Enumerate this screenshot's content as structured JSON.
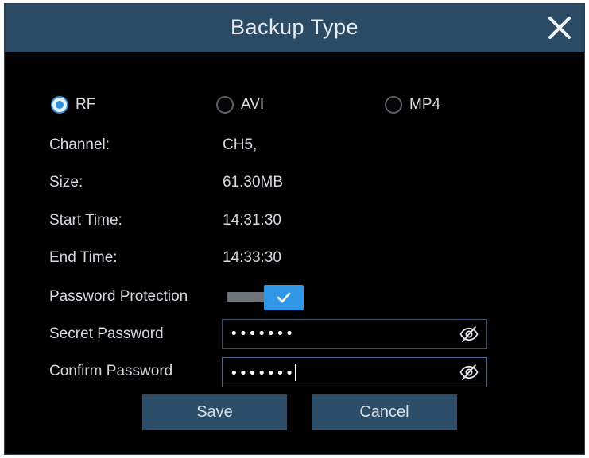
{
  "dialog": {
    "title": "Backup Type",
    "close_icon": "close-icon"
  },
  "backup_format": {
    "options": [
      {
        "label": "RF",
        "checked": true
      },
      {
        "label": "AVI",
        "checked": false
      },
      {
        "label": "MP4",
        "checked": false
      }
    ]
  },
  "info": {
    "channel_label": "Channel:",
    "channel_value": "CH5,",
    "size_label": "Size:",
    "size_value": "61.30MB",
    "start_label": "Start Time:",
    "start_value": "14:31:30",
    "end_label": "End Time:",
    "end_value": "14:33:30"
  },
  "password": {
    "protection_label": "Password Protection",
    "protection_enabled": true,
    "secret_label": "Secret Password",
    "secret_value": "•••••••",
    "confirm_label": "Confirm Password",
    "confirm_value": "•••••••",
    "visibility_icon": "eye-slash-icon"
  },
  "buttons": {
    "save_label": "Save",
    "cancel_label": "Cancel"
  },
  "colors": {
    "titlebar": "#2b4a63",
    "background": "#000000",
    "accent": "#2f97e6",
    "button": "#2d4e68"
  }
}
